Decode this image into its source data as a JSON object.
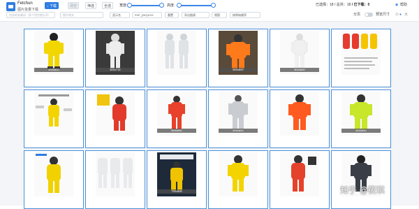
{
  "app": {
    "brand": "Fetchun",
    "subtitle": "图片批量下载"
  },
  "toolbar": {
    "download_label": "↓ 下载",
    "btn2_label": "清空",
    "btn3_label": "筛选",
    "btn4_label": "全选",
    "width_label": "宽度:",
    "height_label": "高度:",
    "filter_placeholder": "包含的关键词（多个用空格分开）",
    "format_placeholder": "图片格式",
    "show_name_label": "显示名",
    "name_value": "FHF_{NO}XXX",
    "rename_label": "重置",
    "export_label": "导出链接",
    "view_label": "视图",
    "sort_label": "按原始顺序",
    "selected_label": "已选择：",
    "selected_value": "18",
    "total_label": "/ 总共：",
    "total_value": "18",
    "downloaded_label": "/ 已下载：",
    "downloaded_value": "0",
    "help_label": "帮助",
    "page_label": "分页",
    "preview_label": "预览尺寸",
    "size_small": "小",
    "size_large": "大"
  },
  "grid": {
    "items": [
      {
        "dims": "600x600"
      },
      {
        "dims": "800x714"
      },
      {
        "dims": ""
      },
      {
        "dims": "800x800"
      },
      {
        "dims": "800x800"
      },
      {
        "dims": ""
      },
      {
        "dims": ""
      },
      {
        "dims": ""
      },
      {
        "dims": "800x800"
      },
      {
        "dims": "800x800"
      },
      {
        "dims": ""
      },
      {
        "dims": "800x800"
      },
      {
        "dims": ""
      },
      {
        "dims": ""
      },
      {
        "dims": "790x806"
      },
      {
        "dims": ""
      },
      {
        "dims": ""
      },
      {
        "dims": ""
      }
    ]
  },
  "watermark": "知乎 @筱琪"
}
